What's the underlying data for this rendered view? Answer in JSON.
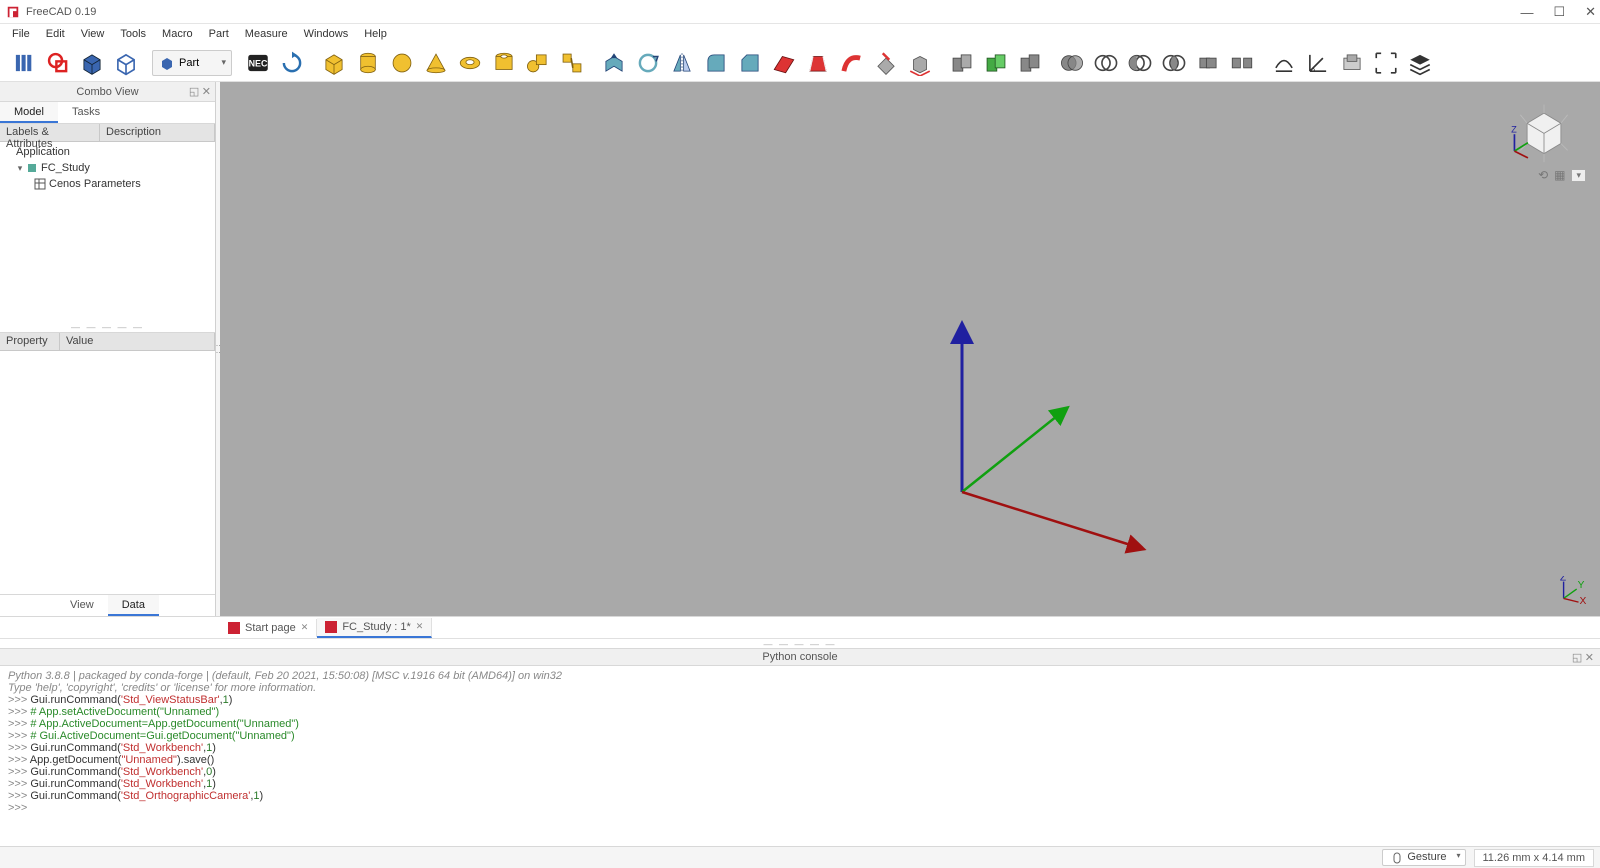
{
  "titlebar": {
    "title": "FreeCAD 0.19"
  },
  "menu": [
    "File",
    "Edit",
    "View",
    "Tools",
    "Macro",
    "Part",
    "Measure",
    "Windows",
    "Help"
  ],
  "workbench": {
    "label": "Part"
  },
  "combo": {
    "title": "Combo View",
    "tabs": {
      "model": "Model",
      "tasks": "Tasks"
    },
    "tree_headers": {
      "labels": "Labels & Attributes",
      "desc": "Description"
    },
    "tree": {
      "root": "Application",
      "doc": "FC_Study",
      "item": "Cenos Parameters"
    },
    "prop_headers": {
      "prop": "Property",
      "val": "Value"
    },
    "bottom_tabs": {
      "view": "View",
      "data": "Data"
    }
  },
  "doc_tabs": {
    "start": "Start page",
    "study": "FC_Study : 1*"
  },
  "python": {
    "title": "Python console",
    "intro1": "Python 3.8.8 | packaged by conda-forge | (default, Feb 20 2021, 15:50:08) [MSC v.1916 64 bit (AMD64)] on win32",
    "intro2": "Type 'help', 'copyright', 'credits' or 'license' for more information.",
    "lines": [
      {
        "t": "Gui.runCommand(",
        "s": "'Std_ViewStatusBar'",
        "r": ",",
        "n": "1",
        "e": ")"
      },
      {
        "comment": "# App.setActiveDocument(\"Unnamed\")"
      },
      {
        "comment": "# App.ActiveDocument=App.getDocument(\"Unnamed\")"
      },
      {
        "comment": "# Gui.ActiveDocument=Gui.getDocument(\"Unnamed\")"
      },
      {
        "t": "Gui.runCommand(",
        "s": "'Std_Workbench'",
        "r": ",",
        "n": "1",
        "e": ")"
      },
      {
        "t": "App.getDocument(",
        "s": "\"Unnamed\"",
        "r": ").save()",
        "n": "",
        "e": ""
      },
      {
        "t": "Gui.runCommand(",
        "s": "'Std_Workbench'",
        "r": ",",
        "n": "0",
        "e": ")"
      },
      {
        "t": "Gui.runCommand(",
        "s": "'Std_Workbench'",
        "r": ",",
        "n": "1",
        "e": ")"
      },
      {
        "t": "Gui.runCommand(",
        "s": "'Std_OrthographicCamera'",
        "r": ",",
        "n": "1",
        "e": ")"
      }
    ]
  },
  "status": {
    "gesture": "Gesture",
    "dim": "11.26 mm x 4.14 mm"
  },
  "axes": {
    "z_label": "Z",
    "y_label": "Y",
    "x_label": "X"
  }
}
